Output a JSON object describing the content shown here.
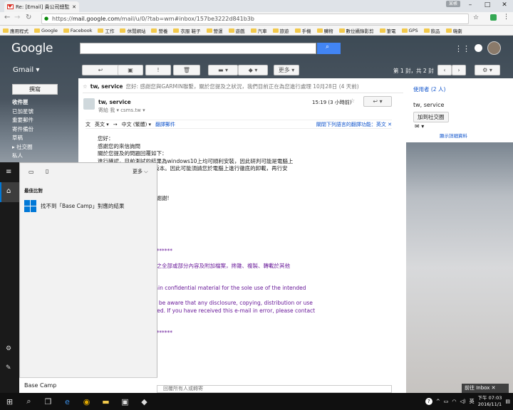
{
  "browser": {
    "tab_title": "Re: [Email] 貴公司總監上...",
    "user_badge": "某帳",
    "url_prefix": "https://",
    "url_host": "mail.google.com",
    "url_path": "/mail/u/0/?tab=wm#inbox/157be3222d841b3b",
    "bookmarks": [
      "應用程式",
      "Google",
      "Facebook",
      "工作",
      "休閒網站",
      "營養",
      "衣服 鞋子",
      "營運",
      "遊戲",
      "汽車",
      "旅遊",
      "手機",
      "購物",
      "數位攝錄影剪",
      "筆電",
      "GPS",
      "飲品",
      "韓劇"
    ]
  },
  "gmail": {
    "logo": "Google",
    "label": "Gmail ▾",
    "compose": "撰寫",
    "nav": [
      "收件匣",
      "已加星號",
      "重要郵件",
      "寄件備份",
      "草稿",
      "▸ 社交圈",
      "私人"
    ],
    "toolbar": {
      "more": "更多 ▾",
      "page_count": "第 1 封，共 2 封"
    }
  },
  "email": {
    "snippet_sender": "tw, service",
    "snippet_text": "您好: 感謝您與GARMIN聯繫，關於您提及之狀況，我們目前正在為您進行處理 10月28日 (4 天前)",
    "sender": "tw, service",
    "time": "15:19 (3 小時前)",
    "to_me": "寄給 我 ▾   csms.tw ▾",
    "translate": {
      "from": "英文 ▾",
      "arrow": "→",
      "to": "中文 (繁體) ▾",
      "translate_link": "翻譯郵件",
      "off_link": "關閉下列語言的翻譯功能：英文 ✕"
    },
    "body_lines": [
      "您好：",
      "感謝您的來信詢問",
      "關於您提及的問題回覆如下：",
      "進行確認，目前測試的結果為windows10上均可順利安裝，因此研判可能是電腦上",
      "導致無法順利安裝4.5.2版本。因此可能須請您於電腦上進行徹底的卸載，再行安",
      "本即可。",
      "",
      "",
      "，也請您再與我們聯繫，謝謝!",
      "",
      "",
      "min Co.",
      "",
      "",
      "樹二路68號",
      "****************************",
      "",
      "同意，不得將本電子郵件之全部或部分內容及附加檔案，搀雜、複製、轉載於其他",
      "",
      "NOTE",
      "ttachments may contain confidential material for the sole use of the intended",
      "",
      "nded recipient, please be aware that any disclosure, copying, distribution or use",
      "attachment is prohibited. If you have received this e-mail in error, please contact",
      "e all copies.",
      "ooperation.",
      "****************************"
    ],
    "reply_placeholder": "回覆所有人或轉寄"
  },
  "contact_panel": {
    "recipients": "使用者 (2 人)",
    "name": "tw, service",
    "add_circle": "加到社交圈",
    "details": "顯示詳細資料"
  },
  "start_menu": {
    "more": "更多",
    "best_match": "最佳比對",
    "result": "找不到「Base Camp」對應的結果",
    "search_text": "Base Camp"
  },
  "taskbar": {
    "go_inbox": "前往 Inbox ✕",
    "time": "下午 07:03",
    "date": "2016/11/1",
    "ime": "英"
  }
}
